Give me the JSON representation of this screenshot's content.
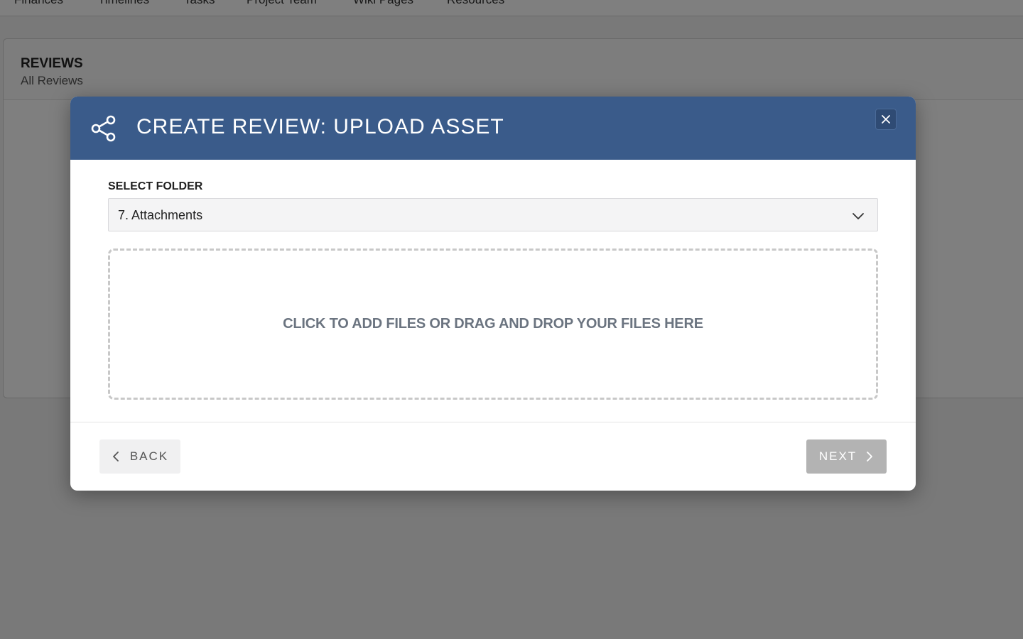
{
  "background": {
    "nav_items": [
      "Finances",
      "Timelines",
      "Tasks",
      "Project Team",
      "Wiki Pages",
      "Resources"
    ],
    "panel": {
      "title": "REVIEWS",
      "subtitle": "All Reviews"
    }
  },
  "modal": {
    "title": "CREATE REVIEW: UPLOAD ASSET",
    "icon": "share-icon",
    "close_icon": "close-icon",
    "folder": {
      "label": "SELECT FOLDER",
      "selected": "7. Attachments"
    },
    "dropzone": {
      "text": "CLICK TO ADD FILES OR DRAG AND DROP YOUR FILES HERE"
    },
    "footer": {
      "back_label": "BACK",
      "next_label": "NEXT"
    }
  },
  "colors": {
    "header": "#3a5b8a",
    "next_disabled": "#b3b3b3",
    "dropzone_text": "#6b7480"
  }
}
